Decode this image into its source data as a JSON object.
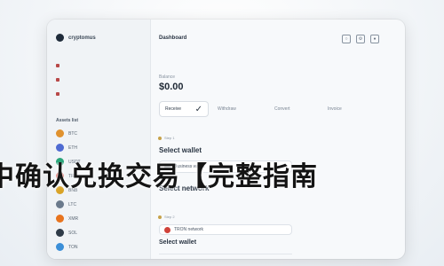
{
  "brand": {
    "name": "cryptomus"
  },
  "sidebar": {
    "nav_items": [
      "",
      "",
      ""
    ],
    "assets_heading": "Assets list",
    "assets": [
      {
        "symbol": "BTC",
        "color": "#e0922f"
      },
      {
        "symbol": "ETH",
        "color": "#4f6bd2"
      },
      {
        "symbol": "USDT",
        "color": "#2aa57a"
      },
      {
        "symbol": "TRX",
        "color": "#d0423a"
      },
      {
        "symbol": "BNB",
        "color": "#d9a326"
      },
      {
        "symbol": "LTC",
        "color": "#6b7a8c"
      },
      {
        "symbol": "XMR",
        "color": "#e8741e"
      },
      {
        "symbol": "SOL",
        "color": "#2f3b48"
      },
      {
        "symbol": "TON",
        "color": "#3b8fd8"
      }
    ]
  },
  "main": {
    "title": "Dashboard",
    "balance_label": "Balance",
    "balance": "$0.00",
    "actions": {
      "receive": "Receive",
      "withdraw": "Withdraw",
      "convert": "Convert",
      "invoice": "Invoice"
    },
    "steps": {
      "select_wallet_hint": "Step 1",
      "select_wallet_title": "Select wallet",
      "wallet_value": "Business wallet",
      "select_network_title": "Select network",
      "network_hint": "Step 2",
      "network_value": "TRON network",
      "select_wallet_bottom": "Select wallet"
    }
  },
  "overlay": {
    "text": "中确认兑换交易【完整指南"
  },
  "colors": {
    "accent": "#c7a24a",
    "text_dark": "#1e2834"
  }
}
